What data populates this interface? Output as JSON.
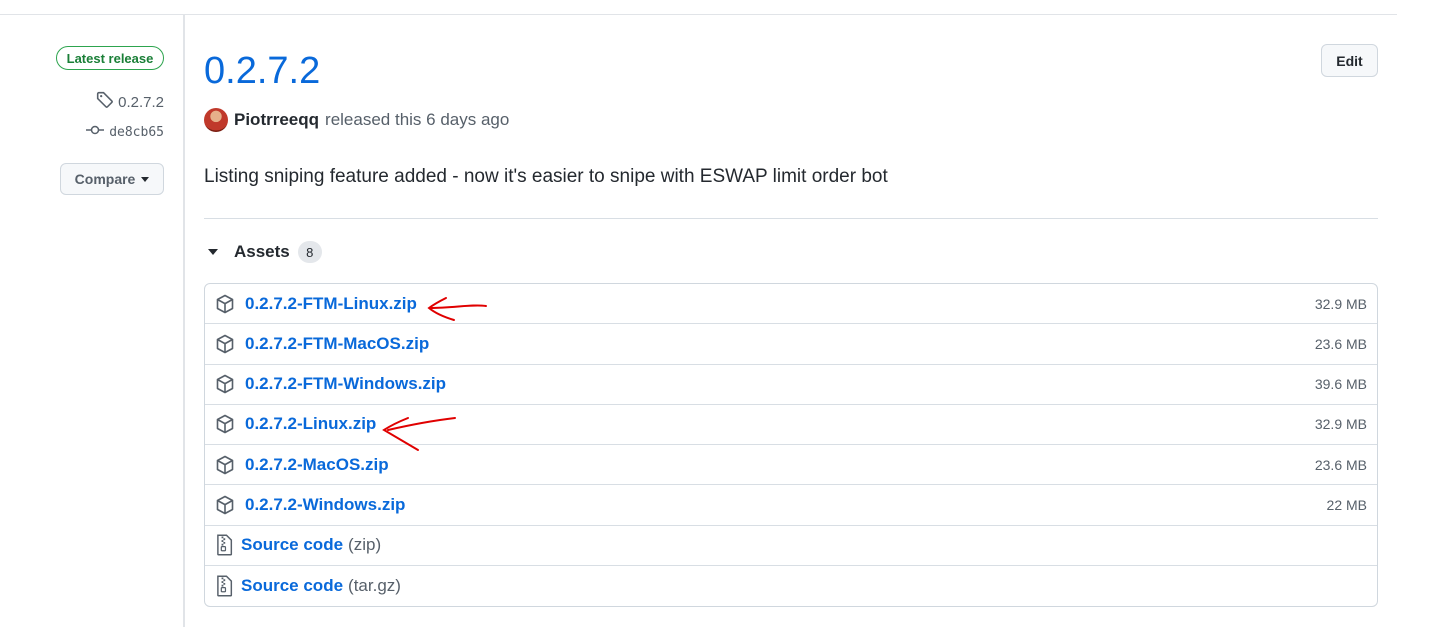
{
  "sidebar": {
    "latest_badge": "Latest release",
    "tag": "0.2.7.2",
    "commit": "de8cb65",
    "compare_label": "Compare"
  },
  "release": {
    "title": "0.2.7.2",
    "edit_label": "Edit",
    "author": "Piotrreeqq",
    "released_text": "released this 6 days ago",
    "body": "Listing sniping feature added - now it's easier to snipe with ESWAP limit order bot"
  },
  "assets": {
    "label": "Assets",
    "count": "8",
    "items": [
      {
        "name": "0.2.7.2-FTM-Linux.zip",
        "size": "32.9 MB",
        "icon": "package-icon",
        "annotated": true
      },
      {
        "name": "0.2.7.2-FTM-MacOS.zip",
        "size": "23.6 MB",
        "icon": "package-icon"
      },
      {
        "name": "0.2.7.2-FTM-Windows.zip",
        "size": "39.6 MB",
        "icon": "package-icon"
      },
      {
        "name": "0.2.7.2-Linux.zip",
        "size": "32.9 MB",
        "icon": "package-icon",
        "annotated": true
      },
      {
        "name": "0.2.7.2-MacOS.zip",
        "size": "23.6 MB",
        "icon": "package-icon"
      },
      {
        "name": "0.2.7.2-Windows.zip",
        "size": "22 MB",
        "icon": "package-icon"
      },
      {
        "name": "Source code",
        "suffix": "(zip)",
        "icon": "file-zip-icon"
      },
      {
        "name": "Source code",
        "suffix": "(tar.gz)",
        "icon": "file-zip-icon"
      }
    ]
  },
  "colors": {
    "link": "#0969da",
    "badge_green": "#1a7f37",
    "annotation_red": "#e00000"
  }
}
